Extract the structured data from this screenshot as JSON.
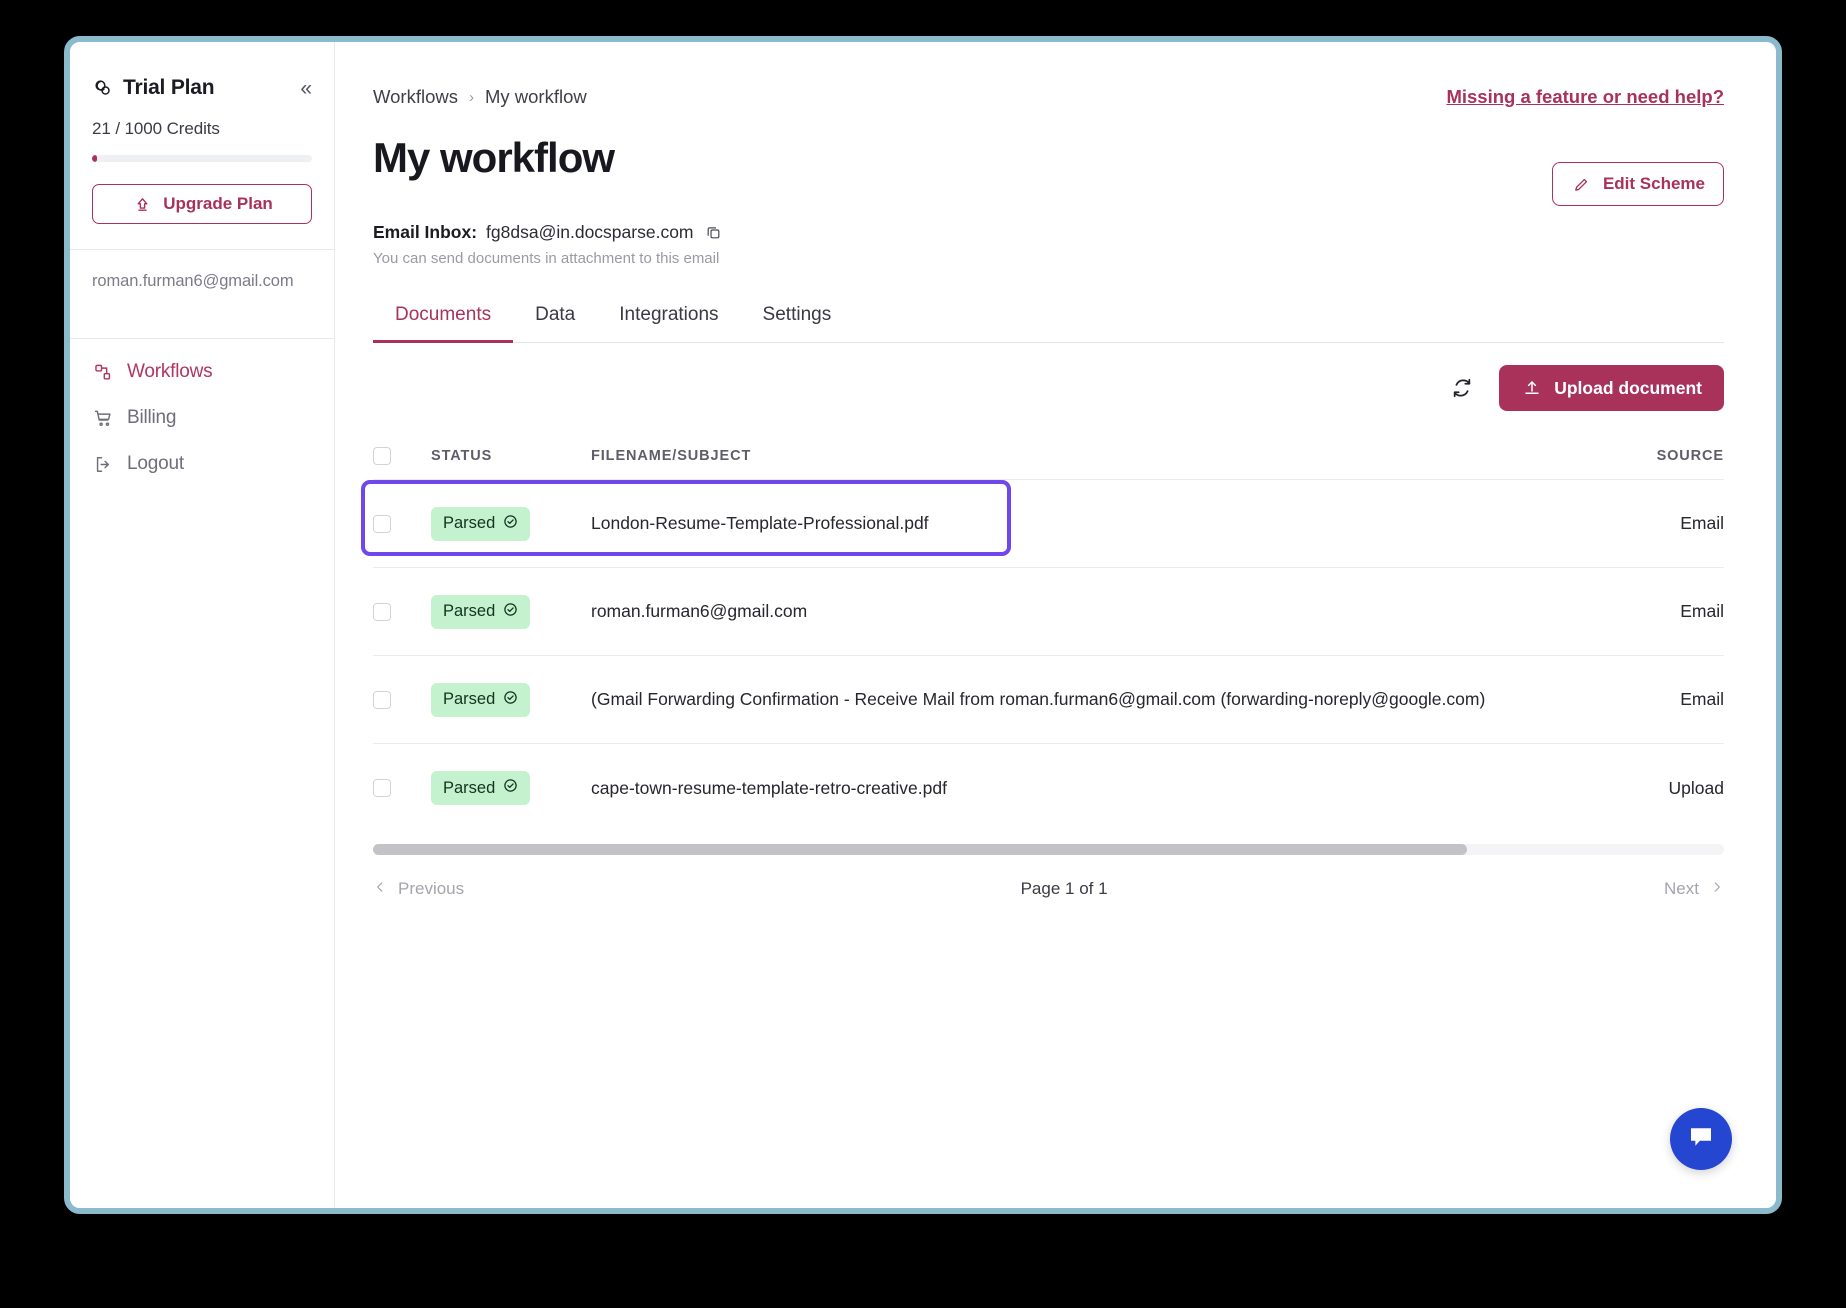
{
  "sidebar": {
    "plan_title": "Trial Plan",
    "plan_icon": "coins-icon",
    "collapse_label": "«",
    "credits_text": "21 / 1000 Credits",
    "credits_used": 21,
    "credits_total": 1000,
    "upgrade_label": "Upgrade Plan",
    "user_email": "roman.furman6@gmail.com",
    "items": [
      {
        "label": "Workflows",
        "icon": "workflows-icon",
        "active": true
      },
      {
        "label": "Billing",
        "icon": "cart-icon",
        "active": false
      },
      {
        "label": "Logout",
        "icon": "logout-icon",
        "active": false
      }
    ]
  },
  "header": {
    "breadcrumb_root": "Workflows",
    "breadcrumb_sep": "›",
    "breadcrumb_current": "My workflow",
    "help_link": "Missing a feature or need help?",
    "page_title": "My workflow",
    "edit_scheme_label": "Edit Scheme",
    "inbox_label": "Email Inbox:",
    "inbox_value": "fg8dsa@in.docsparse.com",
    "inbox_hint": "You can send documents in attachment to this email"
  },
  "tabs": [
    {
      "label": "Documents",
      "active": true
    },
    {
      "label": "Data",
      "active": false
    },
    {
      "label": "Integrations",
      "active": false
    },
    {
      "label": "Settings",
      "active": false
    }
  ],
  "toolbar": {
    "refresh_icon": "refresh-icon",
    "upload_label": "Upload document",
    "upload_icon": "upload-icon"
  },
  "table": {
    "columns": [
      "STATUS",
      "FILENAME/SUBJECT",
      "SOURCE"
    ],
    "rows": [
      {
        "status": "Parsed",
        "filename": "London-Resume-Template-Professional.pdf",
        "source": "Email",
        "selected": true
      },
      {
        "status": "Parsed",
        "filename": "roman.furman6@gmail.com",
        "source": "Email",
        "selected": false
      },
      {
        "status": "Parsed",
        "filename": "(Gmail Forwarding Confirmation - Receive Mail from roman.furman6@gmail.com (forwarding-noreply@google.com)",
        "source": "Email",
        "selected": false
      },
      {
        "status": "Parsed",
        "filename": "cape-town-resume-template-retro-creative.pdf",
        "source": "Upload",
        "selected": false
      }
    ]
  },
  "pagination": {
    "previous_label": "Previous",
    "page_label": "Page 1 of 1",
    "next_label": "Next"
  },
  "chat": {
    "icon": "chat-bubble-icon"
  },
  "colors": {
    "brand": "#a8325a",
    "highlight": "#7047eb",
    "badge_bg": "#c4f2cf",
    "frame": "#8cbacd",
    "chat_blue": "#2546d1"
  }
}
